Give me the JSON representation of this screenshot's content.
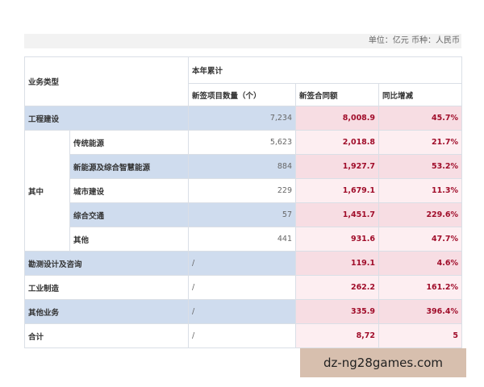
{
  "unit_note": "单位：亿元 币种：人民币",
  "headers": {
    "business_type": "业务类型",
    "ytd": "本年累计",
    "project_count": "新签项目数量（个）",
    "contract_amount": "新签合同额",
    "yoy": "同比增减"
  },
  "group_label": "其中",
  "rows": [
    {
      "label": "工程建设",
      "count": "7,234",
      "amount": "8,008.9",
      "yoy": "45.7%"
    },
    {
      "label": "传统能源",
      "count": "5,623",
      "amount": "2,018.8",
      "yoy": "21.7%"
    },
    {
      "label": "新能源及综合智慧能源",
      "count": "884",
      "amount": "1,927.7",
      "yoy": "53.2%"
    },
    {
      "label": "城市建设",
      "count": "229",
      "amount": "1,679.1",
      "yoy": "11.3%"
    },
    {
      "label": "综合交通",
      "count": "57",
      "amount": "1,451.7",
      "yoy": "229.6%"
    },
    {
      "label": "其他",
      "count": "441",
      "amount": "931.6",
      "yoy": "47.7%"
    },
    {
      "label": "勘测设计及咨询",
      "count": "/",
      "amount": "119.1",
      "yoy": "4.6%"
    },
    {
      "label": "工业制造",
      "count": "/",
      "amount": "262.2",
      "yoy": "161.2%"
    },
    {
      "label": "其他业务",
      "count": "/",
      "amount": "335.9",
      "yoy": "396.4%"
    },
    {
      "label": "合计",
      "count": "/",
      "amount": "8,72",
      "yoy": "5"
    }
  ],
  "watermark": "dz-ng28games.com",
  "colors": {
    "blue_row": "#cfdcee",
    "accent_red": "#a00d2a",
    "pink_cell": "#f7dde3"
  }
}
